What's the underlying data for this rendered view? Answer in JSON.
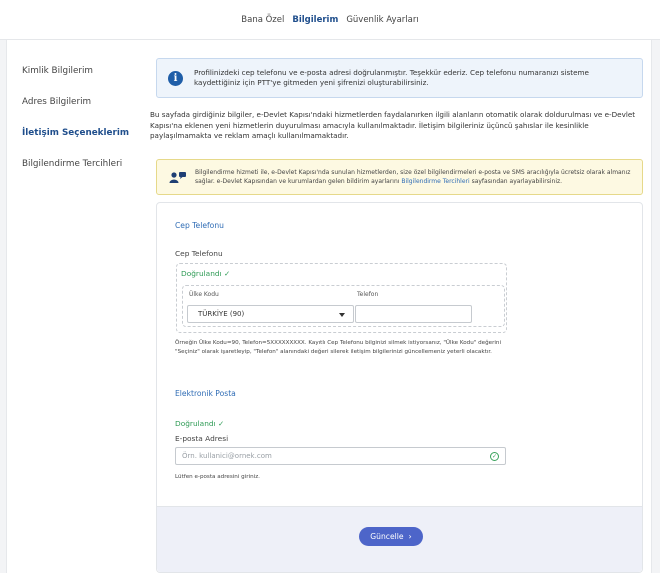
{
  "tabs": [
    {
      "label": "Bana Özel"
    },
    {
      "label": "Bilgilerim"
    },
    {
      "label": "Güvenlik Ayarları"
    }
  ],
  "sidebar": {
    "items": [
      {
        "label": "Kimlik Bilgilerim"
      },
      {
        "label": "Adres Bilgilerim"
      },
      {
        "label": "İletişim Seçeneklerim"
      },
      {
        "label": "Bilgilendirme Tercihleri"
      }
    ]
  },
  "info": {
    "text": "Profilinizdeki cep telefonu ve e-posta adresi doğrulanmıştır. Teşekkür ederiz. Cep telefonu numaranızı sisteme kaydettiğiniz için PTT'ye gitmeden yeni şifrenizi oluşturabilirsiniz."
  },
  "paragraph": "Bu sayfada girdiğiniz bilgiler, e-Devlet Kapısı'ndaki hizmetlerden faydalanırken ilgili alanların otomatik olarak doldurulması ve e-Devlet Kapısı'na eklenen yeni hizmetlerin duyurulması amacıyla kullanılmaktadır. İletişim bilgileriniz üçüncü şahıslar ile kesinlikle paylaşılmamakta ve reklam amaçlı kullanılmamaktadır.",
  "warning": {
    "text_before": "Bilgilendirme hizmeti ile, e-Devlet Kapısı'nda sunulan hizmetlerden, size özel bilgilendirmeleri e-posta ve SMS aracılığıyla ücretsiz olarak almanız sağlar. e-Devlet Kapısından ve kurumlardan gelen bildirim ayarlarını ",
    "link": "Bilgilendirme Tercihleri",
    "text_after": " sayfasından ayarlayabilirsiniz."
  },
  "phone": {
    "section_title": "Cep Telefonu",
    "field_label": "Cep Telefonu",
    "verified": "Doğrulandı ✓",
    "country_label": "Ülke Kodu",
    "country_value": "TÜRKİYE (90)",
    "phone_label": "Telefon",
    "phone_value": "",
    "hint": "Örneğin Ülke Kodu=90, Telefon=5XXXXXXXXX. Kayıtlı Cep Telefonu bilginizi silmek istiyorsanız, \"Ülke Kodu\" değerini \"Seçiniz\" olarak işaretleyip, \"Telefon\" alanındaki değeri silerek iletişim bilgilerinizi güncellemeniz yeterli olacaktır."
  },
  "email": {
    "section_title": "Elektronik Posta",
    "verified": "Doğrulandı ✓",
    "field_label": "E-posta Adresi",
    "placeholder": "Örn. kullanici@ornek.com",
    "hint": "Lütfen e-posta adresini giriniz."
  },
  "actions": {
    "update_label": "Güncelle",
    "update_chevron": "›"
  },
  "colors": {
    "accent": "#1f4e8c",
    "link": "#2f6cb5",
    "success": "#2e9b55",
    "button": "#4d65c9"
  }
}
